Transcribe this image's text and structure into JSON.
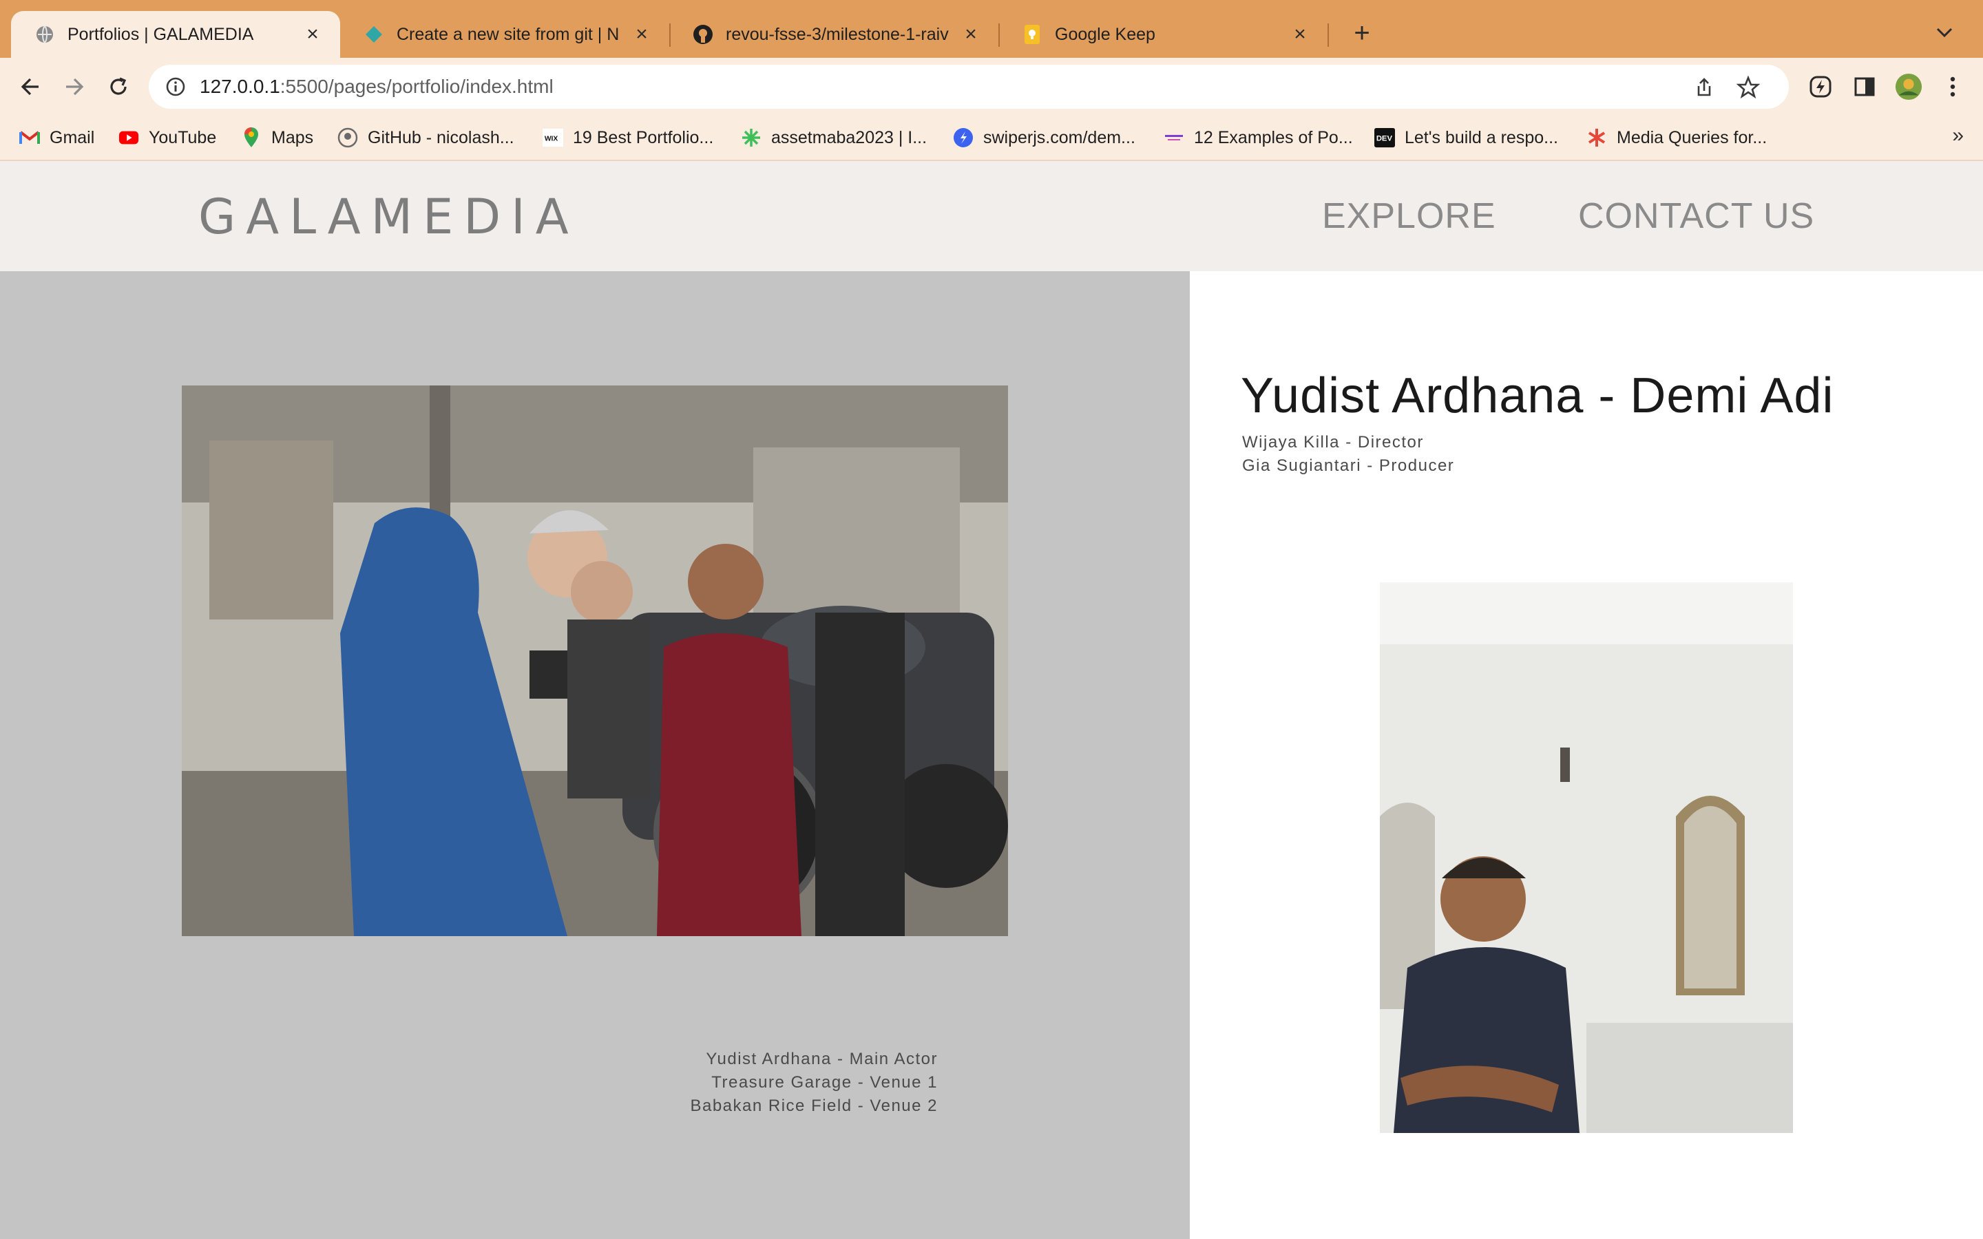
{
  "browser": {
    "tabs": [
      {
        "title": "Portfolios | GALAMEDIA",
        "icon": "globe-icon",
        "active": true
      },
      {
        "title": "Create a new site from git | Ne",
        "icon": "netlify-icon",
        "active": false
      },
      {
        "title": "revou-fsse-3/milestone-1-raiv",
        "icon": "github-icon",
        "active": false
      },
      {
        "title": "Google Keep",
        "icon": "keep-icon",
        "active": false
      }
    ],
    "url_host": "127.0.0.1",
    "url_rest": ":5500/pages/portfolio/index.html",
    "bookmarks": [
      {
        "label": "Gmail",
        "icon": "gmail-icon"
      },
      {
        "label": "YouTube",
        "icon": "youtube-icon"
      },
      {
        "label": "Maps",
        "icon": "maps-icon"
      },
      {
        "label": "GitHub - nicolash...",
        "icon": "github-icon"
      },
      {
        "label": "19 Best Portfolio...",
        "icon": "wix-icon"
      },
      {
        "label": "assetmaba2023 | I...",
        "icon": "asset-icon"
      },
      {
        "label": "swiperjs.com/dem...",
        "icon": "swiper-icon"
      },
      {
        "label": "12 Examples of Po...",
        "icon": "examples-icon"
      },
      {
        "label": "Let's build a respo...",
        "icon": "dev-icon"
      },
      {
        "label": "Media Queries for...",
        "icon": "asterisk-icon"
      }
    ],
    "colors": {
      "tabbar": "#e19d5c",
      "toolbar": "#fbece0"
    }
  },
  "site": {
    "logo": "GALAMEDIA",
    "nav": {
      "explore": "EXPLORE",
      "contact": "CONTACT US"
    },
    "colors": {
      "header_bg": "#f1eeec",
      "left_pane": "#c4c4c4",
      "right_pane": "#ffffff"
    }
  },
  "portfolio": {
    "title": "Yudist Ardhana - Demi Adi",
    "credits_right": [
      "Wijaya Killa - Director",
      "Gia Sugiantari - Producer"
    ],
    "credits_left": [
      "Yudist Ardhana - Main Actor",
      "Treasure Garage - Venue 1",
      "Babakan Rice Field - Venue 2"
    ]
  }
}
